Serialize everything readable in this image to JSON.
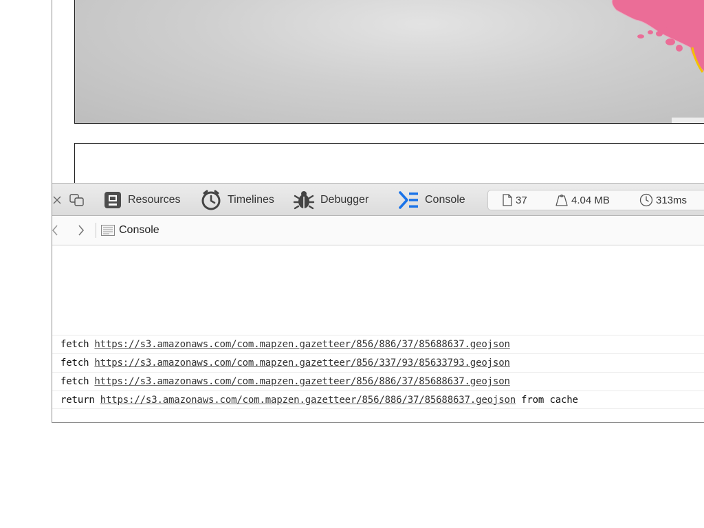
{
  "toolbar": {
    "tabs": [
      {
        "label": "Resources",
        "icon": "resources-icon"
      },
      {
        "label": "Timelines",
        "icon": "timelines-icon"
      },
      {
        "label": "Debugger",
        "icon": "debugger-icon"
      },
      {
        "label": "Console",
        "icon": "console-icon"
      }
    ],
    "dashboard": {
      "resources_count": "37",
      "size": "4.04 MB",
      "time": "313ms"
    }
  },
  "navbar": {
    "crumb_label": "Console"
  },
  "console": {
    "rows": [
      {
        "verb": "fetch",
        "url": "https://s3.amazonaws.com/com.mapzen.gazetteer/856/886/37/85688637.geojson",
        "suffix": ""
      },
      {
        "verb": "fetch",
        "url": "https://s3.amazonaws.com/com.mapzen.gazetteer/856/337/93/85633793.geojson",
        "suffix": ""
      },
      {
        "verb": "fetch",
        "url": "https://s3.amazonaws.com/com.mapzen.gazetteer/856/886/37/85688637.geojson",
        "suffix": ""
      },
      {
        "verb": "return",
        "url": "https://s3.amazonaws.com/com.mapzen.gazetteer/856/886/37/85688637.geojson",
        "suffix": "from cache"
      }
    ]
  },
  "colors": {
    "accent": "#1a73e8",
    "map_pink": "#e9709a",
    "map_outline": "#f2c200"
  }
}
